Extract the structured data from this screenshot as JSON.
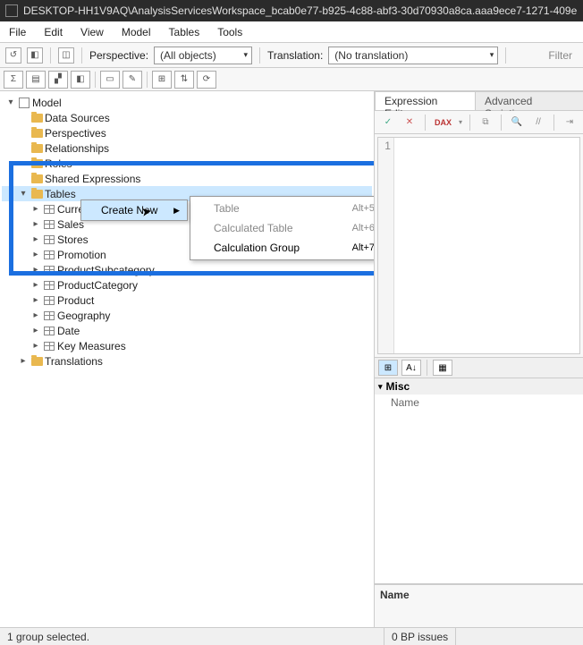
{
  "title": "DESKTOP-HH1V9AQ\\AnalysisServicesWorkspace_bcab0e77-b925-4c88-abf3-30d70930a8ca.aaa9ece7-1271-409e",
  "menu": {
    "file": "File",
    "edit": "Edit",
    "view": "View",
    "model": "Model",
    "tables": "Tables",
    "tools": "Tools"
  },
  "toolbar": {
    "perspective_label": "Perspective:",
    "perspective_value": "(All objects)",
    "translation_label": "Translation:",
    "translation_value": "(No translation)",
    "filter_placeholder": "Filter"
  },
  "tree": {
    "root": "Model",
    "data_sources": "Data Sources",
    "perspectives": "Perspectives",
    "relationships": "Relationships",
    "roles": "Roles",
    "shared_expressions": "Shared Expressions",
    "tables": "Tables",
    "currency": "Currency",
    "sales": "Sales",
    "stores": "Stores",
    "promotion": "Promotion",
    "product_subcategory": "ProductSubcategory",
    "product_category": "ProductCategory",
    "product": "Product",
    "geography": "Geography",
    "date": "Date",
    "key_measures": "Key Measures",
    "translations": "Translations"
  },
  "context1": {
    "create_new": "Create New"
  },
  "context2": {
    "table": {
      "label": "Table",
      "shortcut": "Alt+5"
    },
    "calc_table": {
      "label": "Calculated Table",
      "shortcut": "Alt+6"
    },
    "calc_group": {
      "label": "Calculation Group",
      "shortcut": "Alt+7"
    }
  },
  "tabs": {
    "expression": "Expression Editor",
    "scripting": "Advanced Scripting"
  },
  "expr_toolbar": {
    "dax": "DAX"
  },
  "gutter_line": "1",
  "props": {
    "cat_misc": "Misc",
    "name": "Name",
    "desc_title": "Name"
  },
  "status": {
    "left": "1 group selected.",
    "right": "0 BP issues"
  }
}
